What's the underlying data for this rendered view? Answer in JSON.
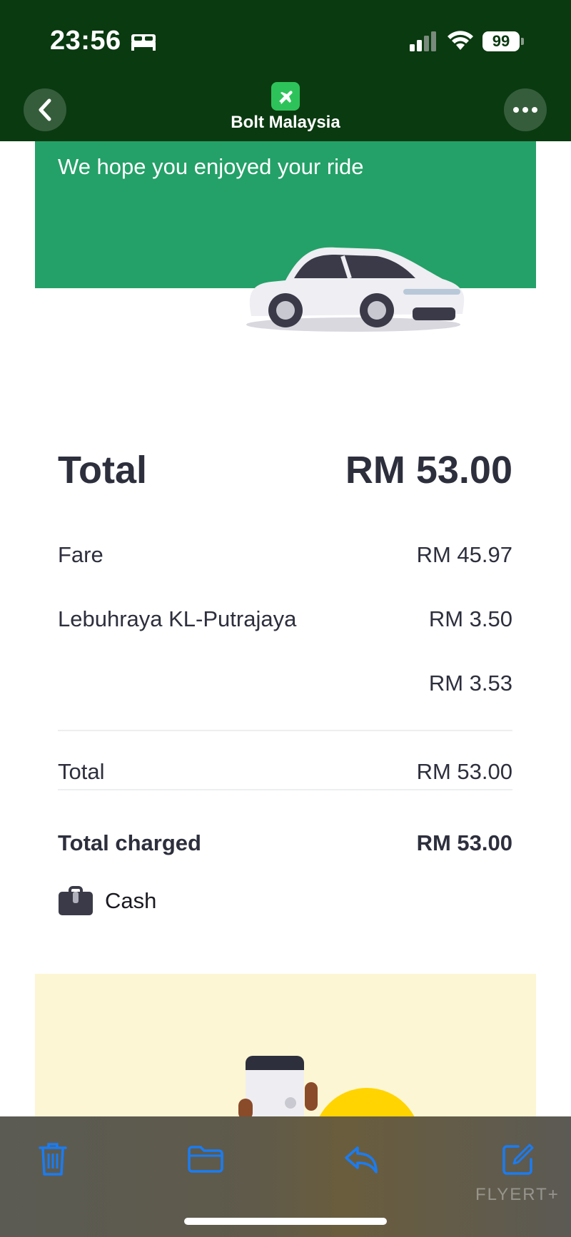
{
  "status_bar": {
    "time": "23:56",
    "battery": "99"
  },
  "nav": {
    "title": "Bolt Malaysia",
    "app_icon": "airplane-icon",
    "back_icon": "chevron-left-icon",
    "more_icon": "ellipsis-icon"
  },
  "email": {
    "hero_text": "We hope you enjoyed your ride",
    "hero_color": "#24a168",
    "total_label": "Total",
    "total_value": "RM 53.00",
    "lines": [
      {
        "label": "Fare",
        "value": "RM 45.97"
      },
      {
        "label": "Lebuhraya KL-Putrajaya",
        "value": "RM 3.50"
      },
      {
        "label": "",
        "value": "RM 3.53"
      }
    ],
    "subtotal_label": "Total",
    "subtotal_value": "RM 53.00",
    "charged_label": "Total charged",
    "charged_value": "RM 53.00",
    "payment_method": "Cash",
    "payment_icon": "wallet-icon"
  },
  "toolbar": {
    "icons": [
      "trash-icon",
      "folder-icon",
      "reply-icon",
      "compose-icon"
    ],
    "accent": "#1a7cf2"
  },
  "watermark": "FLYERT+"
}
